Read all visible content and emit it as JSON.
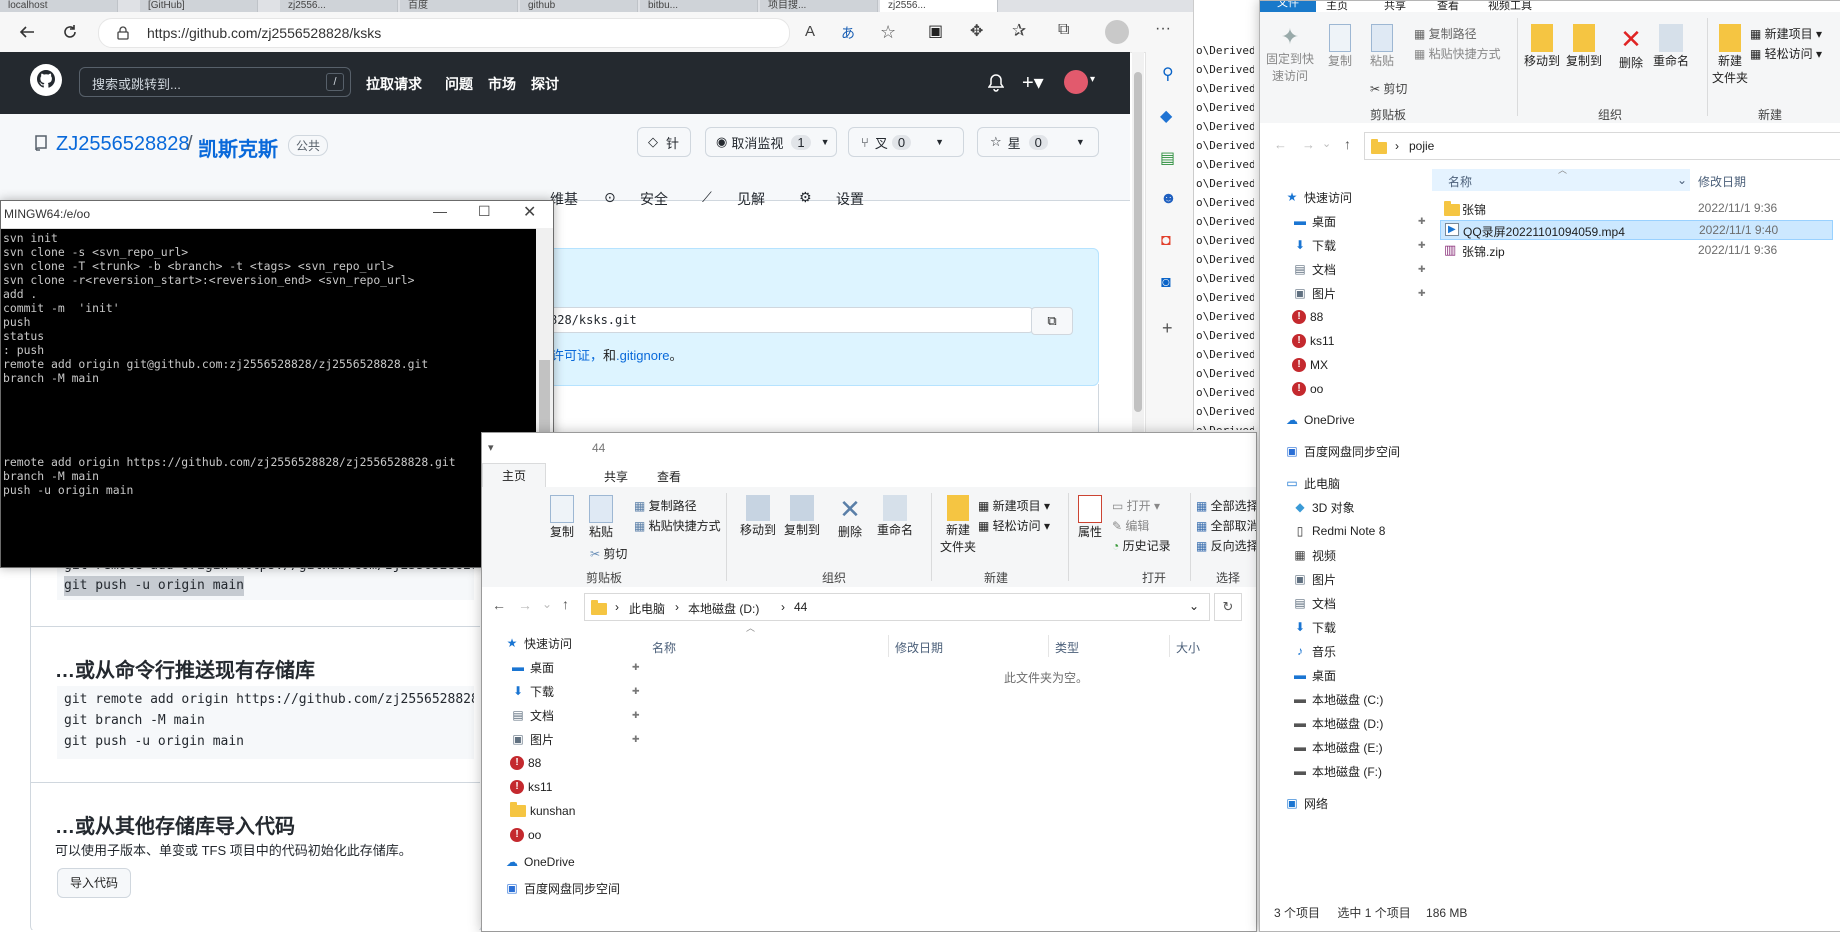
{
  "browser": {
    "tabs": [
      "localhost",
      "[GitHub]",
      "zj2556...",
      "百度",
      "github",
      "bitbu...",
      "项目搜...",
      "zj2556..."
    ],
    "url": "https://github.com/zj2556528828/ksks",
    "read_aloud": "A",
    "translate": "あ"
  },
  "github": {
    "search_placeholder": "搜索或跳转到...",
    "search_key": "/",
    "nav": [
      "拉取请求",
      "问题",
      "市场",
      "探讨"
    ],
    "owner": "ZJ2556528828",
    "separator": "/",
    "repo": "凯斯克斯",
    "visibility": "公共",
    "pin_label": "针",
    "watch_label": "取消监视",
    "watch_count": "1",
    "fork_label": "叉",
    "fork_count": "0",
    "star_label": "星",
    "star_count": "0",
    "tabs": [
      "维基",
      "安全",
      "见解",
      "设置"
    ],
    "clone_url_tail": "828/ksks.git",
    "license_text": "许可证，",
    "and_text": "和",
    "gitignore": ".gitignore",
    "period": "。",
    "cmd_line_1_partial": "git remote add origin https://github.com/zj2556528828/",
    "cmd_line_2_partial": "git push -u origin main",
    "existing_title": "…或从命令行推送现有存储库",
    "existing_cmds": [
      "git remote add origin https://github.com/zj2556528828/",
      "git branch -M main",
      "git push -u origin main"
    ],
    "import_title": "…或从其他存储库导入代码",
    "import_desc": "可以使用子版本、单变或 TFS 项目中的代码初始化此存储库。",
    "import_button": "导入代码"
  },
  "terminal": {
    "title": "MINGW64:/e/oo",
    "lines": [
      "svn init",
      "svn clone -s <svn_repo_url>",
      "svn clone -T <trunk> -b <branch> -t <tags> <svn_repo_url>",
      "svn clone -r<reversion_start>:<reversion_end> <svn_repo_url>",
      "add .",
      "commit -m  'init'",
      "push",
      "status",
      ": push",
      "remote add origin git@github.com:zj2556528828/zj2556528828.git",
      "branch -M main",
      "",
      "",
      "",
      "",
      "",
      "remote add origin https://github.com/zj2556528828/zj2556528828.git",
      "branch -M main",
      "push -u origin main"
    ]
  },
  "explorer44": {
    "title": "44",
    "tabs": [
      "主页",
      "共享",
      "查看"
    ],
    "clipboard": {
      "copy": "复制",
      "paste": "粘贴",
      "copy_path": "复制路径",
      "paste_shortcut": "粘贴快捷方式",
      "cut": "剪切",
      "group": "剪贴板"
    },
    "organize": {
      "move_to": "移动到",
      "copy_to": "复制到",
      "delete": "删除",
      "rename": "重命名",
      "group": "组织"
    },
    "new": {
      "new_folder_l1": "新建",
      "new_folder_l2": "文件夹",
      "new_item": "新建项目",
      "easy_access": "轻松访问",
      "group": "新建"
    },
    "open": {
      "properties": "属性",
      "open": "打开",
      "edit": "编辑",
      "history": "历史记录",
      "group": "打开"
    },
    "select": {
      "select_all": "全部选择",
      "select_none": "全部取消",
      "invert": "反向选择",
      "group": "选择"
    },
    "breadcrumb": [
      "此电脑",
      "本地磁盘 (D:)",
      "44"
    ],
    "columns": [
      "名称",
      "修改日期",
      "类型",
      "大小"
    ],
    "empty": "此文件夹为空。",
    "nav": [
      "快速访问",
      "桌面",
      "下载",
      "文档",
      "图片",
      "88",
      "ks11",
      "kunshan",
      "oo",
      "OneDrive",
      "百度网盘同步空间"
    ]
  },
  "explorerPojie": {
    "tabs": [
      "文件",
      "主页",
      "共享",
      "查看",
      "视频工具"
    ],
    "clipboard": {
      "pin_l1": "固定到快",
      "pin_l2": "速访问",
      "copy": "复制",
      "paste": "粘贴",
      "copy_path": "复制路径",
      "paste_shortcut": "粘贴快捷方式",
      "cut": "剪切",
      "group": "剪贴板"
    },
    "organize": {
      "move_to": "移动到",
      "copy_to": "复制到",
      "delete": "删除",
      "rename": "重命名",
      "group": "组织"
    },
    "new": {
      "new_folder_l1": "新建",
      "new_folder_l2": "文件夹",
      "new_item": "新建项目",
      "easy_access": "轻松访问",
      "group": "新建"
    },
    "path": "pojie",
    "columns": [
      "名称",
      "修改日期"
    ],
    "files": [
      {
        "name": "张锦",
        "date": "2022/11/1 9:36",
        "type": "folder"
      },
      {
        "name": "QQ录屏20221101094059.mp4",
        "date": "2022/11/1 9:40",
        "type": "video"
      },
      {
        "name": "张锦.zip",
        "date": "2022/11/1 9:36",
        "type": "zip"
      }
    ],
    "nav": [
      "快速访问",
      "桌面",
      "下载",
      "文档",
      "图片",
      "88",
      "ks11",
      "MX",
      "oo",
      "OneDrive",
      "百度网盘同步空间",
      "此电脑",
      "3D 对象",
      "Redmi Note 8",
      "视频",
      "图片",
      "文档",
      "下载",
      "音乐",
      "桌面",
      "本地磁盘 (C:)",
      "本地磁盘 (D:)",
      "本地磁盘 (E:)",
      "本地磁盘 (F:)",
      "网络"
    ],
    "status": {
      "count": "3 个项目",
      "selected": "选中 1 个项目",
      "size": "186 MB"
    },
    "behind_lines": "o\\DerivedDa"
  }
}
